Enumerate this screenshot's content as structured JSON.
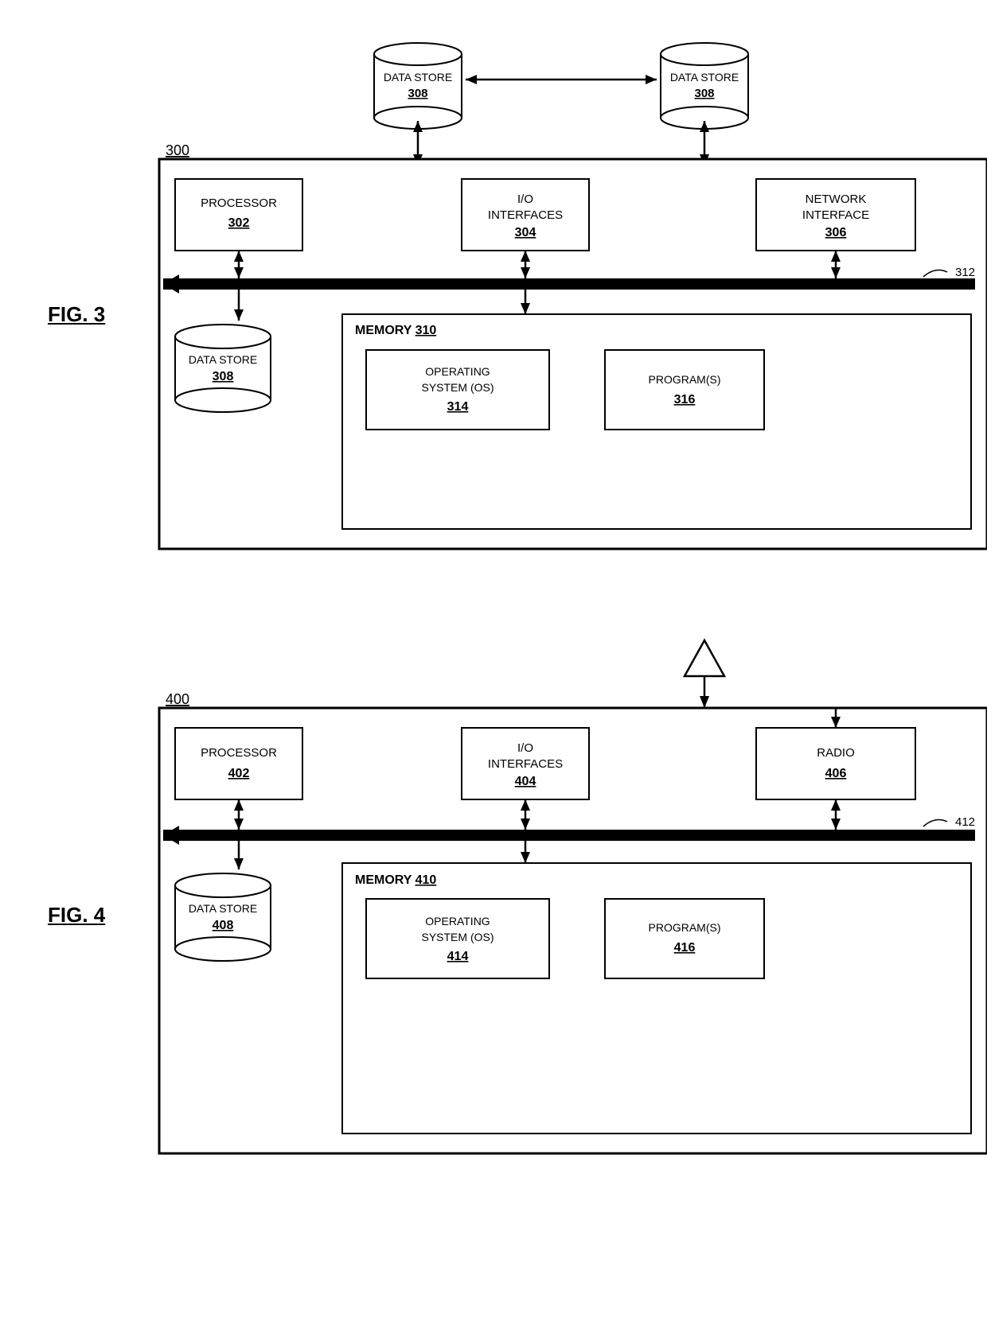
{
  "fig3": {
    "label": "FIG. 3",
    "box_label": "300",
    "components": [
      {
        "name": "PROCESSOR",
        "num": "302"
      },
      {
        "name": "I/O\nINTERFACES",
        "num": "304"
      },
      {
        "name": "NETWORK\nINTERFACE",
        "num": "306"
      }
    ],
    "bus_num": "312",
    "datastore_top": {
      "label": "DATA STORE",
      "num": "308"
    },
    "datastore_bottom": {
      "label": "DATA STORE",
      "num": "308"
    },
    "memory": {
      "label": "MEMORY",
      "num": "310",
      "os": {
        "name": "OPERATING\nSYSTEM (OS)",
        "num": "314"
      },
      "programs": {
        "name": "PROGRAM(S)",
        "num": "316"
      }
    }
  },
  "fig4": {
    "label": "FIG. 4",
    "box_label": "400",
    "components": [
      {
        "name": "PROCESSOR",
        "num": "402"
      },
      {
        "name": "I/O\nINTERFACES",
        "num": "404"
      },
      {
        "name": "RADIO",
        "num": "406"
      }
    ],
    "bus_num": "412",
    "datastore": {
      "label": "DATA STORE",
      "num": "408"
    },
    "memory": {
      "label": "MEMORY",
      "num": "410",
      "os": {
        "name": "OPERATING\nSYSTEM (OS)",
        "num": "414"
      },
      "programs": {
        "name": "PROGRAM(S)",
        "num": "416"
      }
    }
  }
}
